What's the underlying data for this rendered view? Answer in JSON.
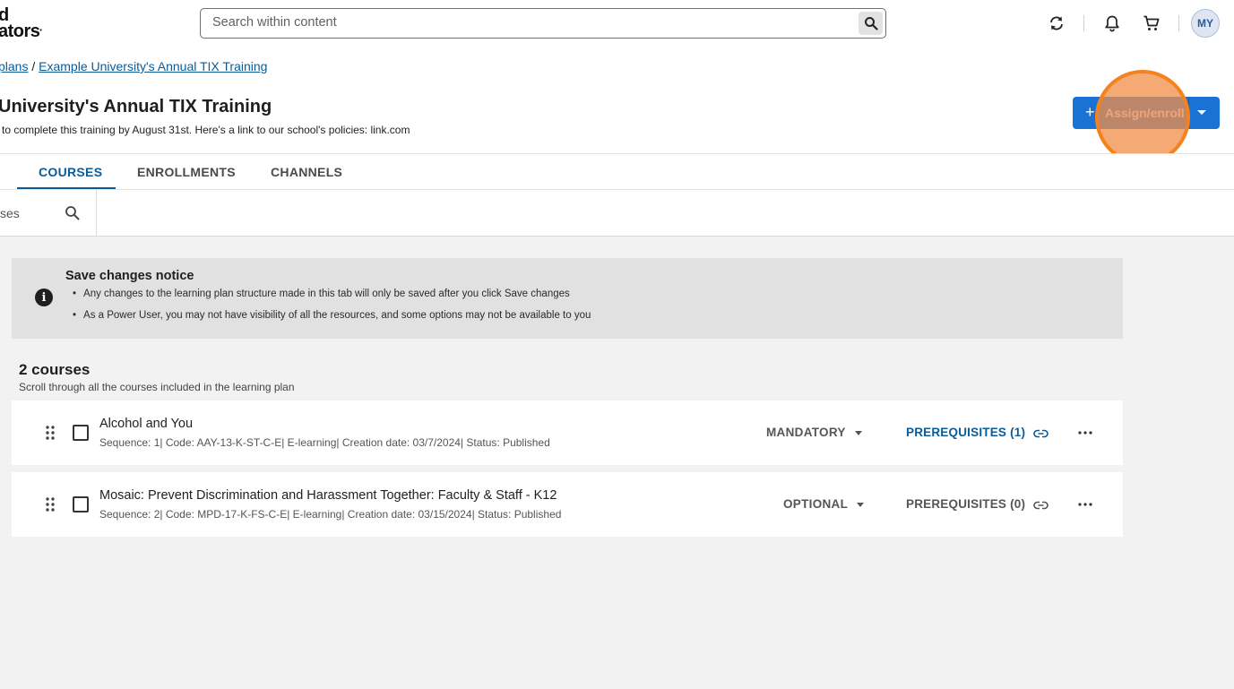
{
  "topbar": {
    "logo_line1": "d",
    "logo_line2": "ators",
    "search_placeholder": "Search within content",
    "avatar_initials": "MY",
    "icons": [
      "search-icon",
      "sync-icon",
      "bell-icon",
      "cart-icon"
    ]
  },
  "breadcrumb": {
    "parent": "plans",
    "separator": " / ",
    "current": "Example University's Annual TIX Training"
  },
  "page": {
    "title": "University's Annual TIX Training",
    "subtitle": "to complete this training by August 31st.  Here's a link to our school's policies: link.com",
    "assign_button_label": "Assign/enroll",
    "assign_plus": "+"
  },
  "tabs": [
    {
      "label": "COURSES",
      "active": true
    },
    {
      "label": "ENROLLMENTS",
      "active": false
    },
    {
      "label": "CHANNELS",
      "active": false
    }
  ],
  "filter": {
    "search_text": "ses"
  },
  "notice": {
    "title": "Save changes notice",
    "items": [
      "Any changes to the learning plan structure made in this tab will only be saved after you click Save changes",
      "As a Power User, you may not have visibility of all the resources, and some options may not be available to you"
    ]
  },
  "courses": {
    "count_label": "2 courses",
    "subtitle": "Scroll through all the courses included in the learning plan",
    "items": [
      {
        "title": "Alcohol and You",
        "meta": "Sequence: 1| Code: AAY-13-K-ST-C-E| E-learning| Creation date: 03/7/2024| Status: Published",
        "type": "MANDATORY",
        "prerequisites": "PREREQUISITES (1)",
        "prereq_color": "#0b5b97"
      },
      {
        "title": "Mosaic: Prevent Discrimination and Harassment Together: Faculty & Staff - K12",
        "meta": "Sequence: 2| Code: MPD-17-K-FS-C-E| E-learning| Creation date: 03/15/2024| Status: Published",
        "type": "OPTIONAL",
        "prerequisites": "PREREQUISITES (0)",
        "prereq_color": "#555555"
      }
    ]
  },
  "colors": {
    "accent_blue": "#1a73d4",
    "link_blue": "#0b5b97",
    "highlight_orange": "#f5821f"
  }
}
